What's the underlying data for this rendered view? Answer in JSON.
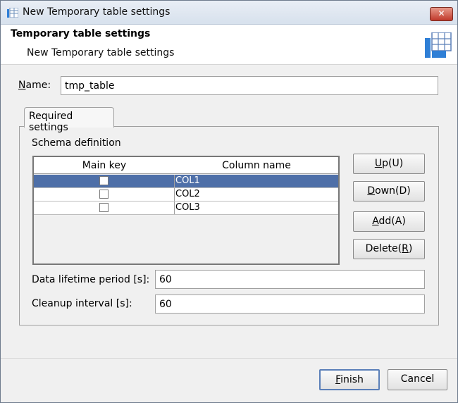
{
  "window": {
    "title": "New Temporary table settings",
    "close_glyph": "✕"
  },
  "header": {
    "title": "Temporary table settings",
    "subtitle": "New Temporary table settings",
    "icon": "table-grid-icon"
  },
  "name_field": {
    "label_u": "N",
    "label_rest": "ame:",
    "value": "tmp_table"
  },
  "tabs": [
    {
      "label": "Required settings"
    }
  ],
  "schema": {
    "title": "Schema definition",
    "headers": {
      "main_key": "Main key",
      "column_name": "Column name"
    },
    "rows": [
      {
        "main_key": false,
        "column_name": "COL1",
        "selected": true
      },
      {
        "main_key": false,
        "column_name": "COL2",
        "selected": false
      },
      {
        "main_key": false,
        "column_name": "COL3",
        "selected": false
      }
    ]
  },
  "side_buttons": {
    "up": {
      "u": "U",
      "rest": "p(U)"
    },
    "down": {
      "u": "D",
      "rest": "own(D)"
    },
    "add": {
      "u": "A",
      "rest": "dd(A)"
    },
    "delete": {
      "pre": "Delete(",
      "u": "R",
      "post": ")"
    }
  },
  "lifetime": {
    "label": "Data lifetime period [s]:",
    "value": "60"
  },
  "cleanup": {
    "label": "Cleanup interval [s]:",
    "value": "60"
  },
  "footer": {
    "finish": {
      "u": "F",
      "rest": "inish"
    },
    "cancel": "Cancel"
  },
  "colors": {
    "selection": "#4e6fa8",
    "accent_blue": "#2f7fd6",
    "close_red": "#c0392b"
  }
}
